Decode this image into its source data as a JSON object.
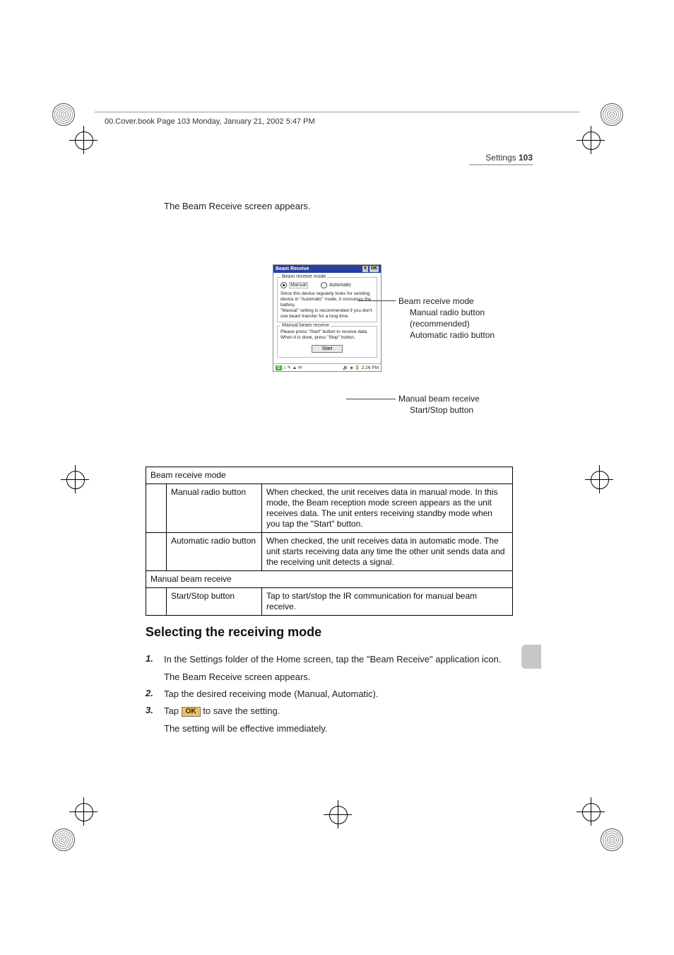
{
  "running_head": "00.Cover.book  Page 103  Monday, January 21, 2002  5:47 PM",
  "header": {
    "section": "Settings",
    "page": "103"
  },
  "intro_text": "The Beam Receive screen appears.",
  "figure": {
    "title": "Beam Receive",
    "close_label": "X",
    "ok_label": "OK",
    "group1": {
      "legend": "Beam receive mode",
      "manual": "Manual",
      "automatic": "Automatic",
      "desc": "Since this device regularly looks for sending device in \"Automatic\" mode, it consumes the battery.\n\"Manual\" setting is recommended if you don't use beam transfer for a long time."
    },
    "group2": {
      "legend": "Manual beam receive",
      "desc": "Please press \"Start\" button to receive data. When it is done, press \"Stop\" button.",
      "start": "Start"
    },
    "taskbar": {
      "start": "G",
      "time": "2:26 PM"
    }
  },
  "callout1": {
    "line1": "Beam receive mode",
    "line2": "Manual radio button",
    "line3": "(recommended)",
    "line4": "Automatic radio button"
  },
  "callout2": {
    "line1": "Manual beam receive",
    "line2": "Start/Stop button"
  },
  "table": {
    "r1c1": "Beam receive mode",
    "r2c1": "Manual radio button",
    "r2c2": "When checked, the unit receives data in manual mode. In this mode, the Beam reception mode screen appears as the unit receives data. The unit enters receiving standby mode when you tap the \"Start\" button.",
    "r3c1": "Automatic radio button",
    "r3c2": "When checked, the unit receives data in automatic mode. The unit starts receiving data any time the other unit sends data and the receiving unit detects a signal.",
    "r4c1": "Manual beam receive",
    "r5c1": "Start/Stop button",
    "r5c2": "Tap to start/stop the IR communication for manual beam receive."
  },
  "heading2": "Selecting the receiving mode",
  "steps": {
    "s1": "In the Settings folder of the Home screen, tap the \"Beam Receive\" application icon.",
    "s1_after": "The Beam Receive screen appears.",
    "s2": "Tap the desired receiving mode (Manual, Automatic).",
    "s3a": "Tap ",
    "s3_ok": "OK",
    "s3b": " to save the setting.",
    "s3_after": "The setting will be effective immediately."
  }
}
